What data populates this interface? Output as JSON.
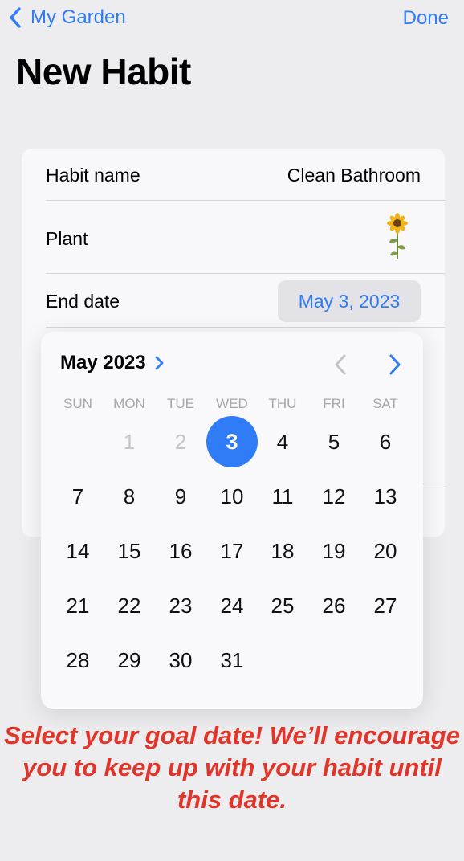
{
  "nav": {
    "back_label": "My Garden",
    "done_label": "Done"
  },
  "title": "New Habit",
  "form": {
    "habit_name_label": "Habit name",
    "habit_name_value": "Clean Bathroom",
    "plant_label": "Plant",
    "plant_icon": "sunflower-icon",
    "end_date_label": "End date",
    "end_date_value": "May 3, 2023"
  },
  "calendar": {
    "month_label": "May 2023",
    "weekdays": [
      "SUN",
      "MON",
      "TUE",
      "WED",
      "THU",
      "FRI",
      "SAT"
    ],
    "leading_disabled_days": [
      "1",
      "2"
    ],
    "days": [
      "3",
      "4",
      "5",
      "6",
      "7",
      "8",
      "9",
      "10",
      "11",
      "12",
      "13",
      "14",
      "15",
      "16",
      "17",
      "18",
      "19",
      "20",
      "21",
      "22",
      "23",
      "24",
      "25",
      "26",
      "27",
      "28",
      "29",
      "30",
      "31"
    ],
    "selected_day": "3",
    "accent_color": "#2f7cf6"
  },
  "caption": "Select your goal date! We’ll encourage you to keep up with your habit until this date.",
  "colors": {
    "accent": "#2f7cf6",
    "caption": "#e1352a"
  }
}
